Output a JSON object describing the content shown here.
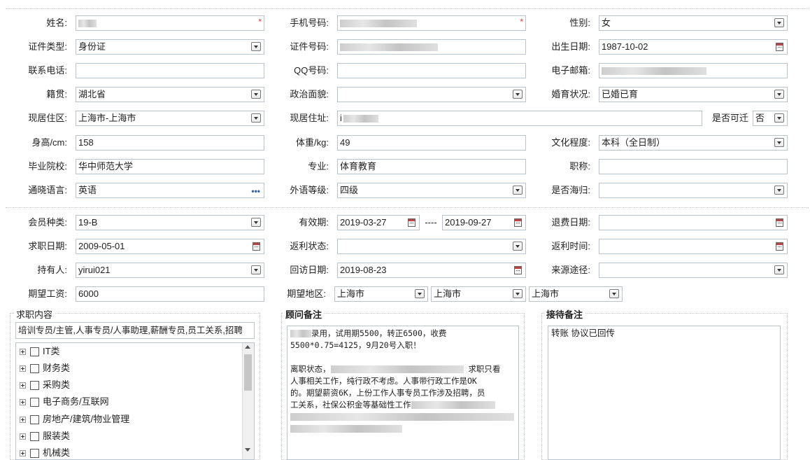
{
  "personal": {
    "name": {
      "label": "姓名:",
      "value": ""
    },
    "phone": {
      "label": "手机号码:",
      "value": ""
    },
    "gender": {
      "label": "性别:",
      "value": "女"
    },
    "id_type": {
      "label": "证件类型:",
      "value": "身份证"
    },
    "id_number": {
      "label": "证件号码:",
      "value": ""
    },
    "birth_date": {
      "label": "出生日期:",
      "value": "1987-10-02"
    },
    "tel": {
      "label": "联系电话:",
      "value": ""
    },
    "qq": {
      "label": "QQ号码:",
      "value": ""
    },
    "email": {
      "label": "电子邮箱:",
      "value": ""
    },
    "native_place": {
      "label": "籍贯:",
      "value": "湖北省"
    },
    "political": {
      "label": "政治面貌:",
      "value": ""
    },
    "marital": {
      "label": "婚育状况:",
      "value": "已婚已育"
    },
    "residence_area": {
      "label": "现居住区:",
      "value": "上海市-上海市"
    },
    "residence_addr": {
      "label": "现居住址:",
      "value": "i"
    },
    "relocatable": {
      "label": "是否可迁",
      "value": "否"
    },
    "height": {
      "label": "身高/cm:",
      "value": "158"
    },
    "weight": {
      "label": "体重/kg:",
      "value": "49"
    },
    "education": {
      "label": "文化程度:",
      "value": "本科（全日制）"
    },
    "school": {
      "label": "毕业院校:",
      "value": "华中师范大学"
    },
    "major": {
      "label": "专业:",
      "value": "体育教育"
    },
    "title": {
      "label": "职称:",
      "value": ""
    },
    "language": {
      "label": "通晓语言:",
      "value": "英语"
    },
    "lang_level": {
      "label": "外语等级:",
      "value": "四级"
    },
    "overseas": {
      "label": "是否海归:",
      "value": ""
    }
  },
  "membership": {
    "member_type": {
      "label": "会员种类:",
      "value": "19-B"
    },
    "valid_period": {
      "label": "有效期:",
      "start": "2019-03-27",
      "sep": "----",
      "end": "2019-09-27"
    },
    "refund_date": {
      "label": "退费日期:",
      "value": ""
    },
    "apply_date": {
      "label": "求职日期:",
      "value": "2009-05-01"
    },
    "rebate_status": {
      "label": "返利状态:",
      "value": ""
    },
    "rebate_time": {
      "label": "返利时间:",
      "value": ""
    },
    "holder": {
      "label": "持有人:",
      "value": "yirui021"
    },
    "visit_date": {
      "label": "回访日期:",
      "value": "2019-08-23"
    },
    "source": {
      "label": "来源途径:",
      "value": ""
    },
    "salary": {
      "label": "期望工资:",
      "value": "6000"
    },
    "region": {
      "label": "期望地区:",
      "r1": "上海市",
      "r2": "上海市",
      "r3": "上海市"
    }
  },
  "job_panel": {
    "title": "求职内容",
    "summary": "培训专员/主管,人事专员/人事助理,薪酬专员,员工关系,招聘",
    "tree": [
      "IT类",
      "财务类",
      "采购类",
      "电子商务/互联网",
      "房地产/建筑/物业管理",
      "服装类",
      "机械类"
    ]
  },
  "advisor_panel": {
    "title": "顾问备注",
    "line1": "录用，试用期5500，转正6500，收费",
    "line2": "5500*0.75=4125，9月20号入职！",
    "line3_a": "离职状态，",
    "line3_b": "求职只看",
    "line4": "人事相关工作，纯行政不考虑。人事带行政工作是OK",
    "line5": "的。期望薪资6K，上份工作人事专员工作涉及招聘，员",
    "line6": "工关系，社保公积金等基础性工作"
  },
  "reception_panel": {
    "title": "接待备注",
    "text": "转账 协议已回传"
  }
}
